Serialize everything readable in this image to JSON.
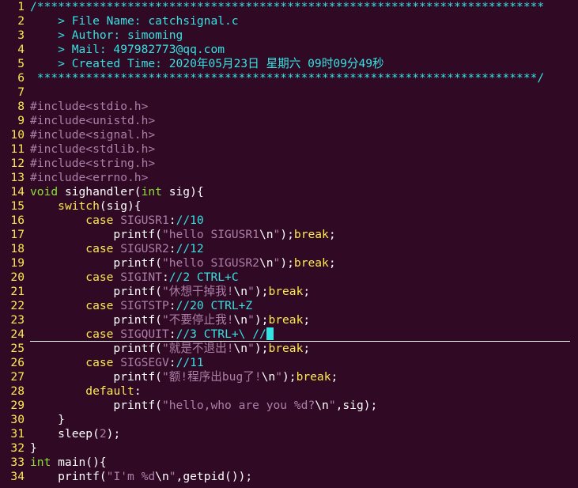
{
  "editor": {
    "file_name": "catchsignal.c",
    "mode": "vim",
    "colors": {
      "background": "#300a24",
      "line_number": "#fce94f",
      "comment": "#34e2e2",
      "preproc": "#ad7fa8",
      "type": "#8ae234",
      "statement": "#fce94f",
      "string": "#ad7fa8",
      "constant": "#ad7fa8",
      "normal": "#ffffff",
      "cursor": "#34e2e2"
    },
    "lines": [
      {
        "num": "1",
        "tokens": [
          {
            "c": "comment",
            "t": "/*************************************************************************"
          }
        ]
      },
      {
        "num": "2",
        "tokens": [
          {
            "c": "comment",
            "t": "    > File Name: catchsignal.c"
          }
        ]
      },
      {
        "num": "3",
        "tokens": [
          {
            "c": "comment",
            "t": "    > Author: simoming"
          }
        ]
      },
      {
        "num": "4",
        "tokens": [
          {
            "c": "comment",
            "t": "    > Mail: 497982773@qq.com"
          }
        ]
      },
      {
        "num": "5",
        "tokens": [
          {
            "c": "comment",
            "t": "    > Created Time: 2020年05月23日 星期六 09时09分49秒"
          }
        ]
      },
      {
        "num": "6",
        "tokens": [
          {
            "c": "comment",
            "t": " ************************************************************************/"
          }
        ]
      },
      {
        "num": "7",
        "tokens": []
      },
      {
        "num": "8",
        "tokens": [
          {
            "c": "preproc",
            "t": "#include"
          },
          {
            "c": "string",
            "t": "<stdio.h>"
          }
        ]
      },
      {
        "num": "9",
        "tokens": [
          {
            "c": "preproc",
            "t": "#include"
          },
          {
            "c": "string",
            "t": "<unistd.h>"
          }
        ]
      },
      {
        "num": "10",
        "tokens": [
          {
            "c": "preproc",
            "t": "#include"
          },
          {
            "c": "string",
            "t": "<signal.h>"
          }
        ]
      },
      {
        "num": "11",
        "tokens": [
          {
            "c": "preproc",
            "t": "#include"
          },
          {
            "c": "string",
            "t": "<stdlib.h>"
          }
        ]
      },
      {
        "num": "12",
        "tokens": [
          {
            "c": "preproc",
            "t": "#include"
          },
          {
            "c": "string",
            "t": "<string.h>"
          }
        ]
      },
      {
        "num": "13",
        "tokens": [
          {
            "c": "preproc",
            "t": "#include"
          },
          {
            "c": "string",
            "t": "<errno.h>"
          }
        ]
      },
      {
        "num": "14",
        "tokens": [
          {
            "c": "type",
            "t": "void"
          },
          {
            "c": "normal",
            "t": " sighandler("
          },
          {
            "c": "type",
            "t": "int"
          },
          {
            "c": "normal",
            "t": " sig){"
          }
        ]
      },
      {
        "num": "15",
        "tokens": [
          {
            "c": "normal",
            "t": "    "
          },
          {
            "c": "statement",
            "t": "switch"
          },
          {
            "c": "normal",
            "t": "(sig){"
          }
        ]
      },
      {
        "num": "16",
        "tokens": [
          {
            "c": "normal",
            "t": "        "
          },
          {
            "c": "statement",
            "t": "case"
          },
          {
            "c": "normal",
            "t": " "
          },
          {
            "c": "constant",
            "t": "SIGUSR1"
          },
          {
            "c": "normal",
            "t": ":"
          },
          {
            "c": "comment",
            "t": "//10"
          }
        ]
      },
      {
        "num": "17",
        "tokens": [
          {
            "c": "normal",
            "t": "            printf("
          },
          {
            "c": "string",
            "t": "\"hello SIGUSR1"
          },
          {
            "c": "normal",
            "t": "\\n"
          },
          {
            "c": "string",
            "t": "\""
          },
          {
            "c": "normal",
            "t": ");"
          },
          {
            "c": "statement",
            "t": "break"
          },
          {
            "c": "normal",
            "t": ";"
          }
        ]
      },
      {
        "num": "18",
        "tokens": [
          {
            "c": "normal",
            "t": "        "
          },
          {
            "c": "statement",
            "t": "case"
          },
          {
            "c": "normal",
            "t": " "
          },
          {
            "c": "constant",
            "t": "SIGUSR2"
          },
          {
            "c": "normal",
            "t": ":"
          },
          {
            "c": "comment",
            "t": "//12"
          }
        ]
      },
      {
        "num": "19",
        "tokens": [
          {
            "c": "normal",
            "t": "            printf("
          },
          {
            "c": "string",
            "t": "\"hello SIGUSR2"
          },
          {
            "c": "normal",
            "t": "\\n"
          },
          {
            "c": "string",
            "t": "\""
          },
          {
            "c": "normal",
            "t": ");"
          },
          {
            "c": "statement",
            "t": "break"
          },
          {
            "c": "normal",
            "t": ";"
          }
        ]
      },
      {
        "num": "20",
        "tokens": [
          {
            "c": "normal",
            "t": "        "
          },
          {
            "c": "statement",
            "t": "case"
          },
          {
            "c": "normal",
            "t": " "
          },
          {
            "c": "constant",
            "t": "SIGINT"
          },
          {
            "c": "normal",
            "t": ":"
          },
          {
            "c": "comment",
            "t": "//2 CTRL+C"
          }
        ]
      },
      {
        "num": "21",
        "tokens": [
          {
            "c": "normal",
            "t": "            printf("
          },
          {
            "c": "string",
            "t": "\"休想干掉我!"
          },
          {
            "c": "normal",
            "t": "\\n"
          },
          {
            "c": "string",
            "t": "\""
          },
          {
            "c": "normal",
            "t": ");"
          },
          {
            "c": "statement",
            "t": "break"
          },
          {
            "c": "normal",
            "t": ";"
          }
        ]
      },
      {
        "num": "22",
        "tokens": [
          {
            "c": "normal",
            "t": "        "
          },
          {
            "c": "statement",
            "t": "case"
          },
          {
            "c": "normal",
            "t": " "
          },
          {
            "c": "constant",
            "t": "SIGTSTP"
          },
          {
            "c": "normal",
            "t": ":"
          },
          {
            "c": "comment",
            "t": "//20 CTRL+Z"
          }
        ]
      },
      {
        "num": "23",
        "tokens": [
          {
            "c": "normal",
            "t": "            printf("
          },
          {
            "c": "string",
            "t": "\"不要停止我!"
          },
          {
            "c": "normal",
            "t": "\\n"
          },
          {
            "c": "string",
            "t": "\""
          },
          {
            "c": "normal",
            "t": ");"
          },
          {
            "c": "statement",
            "t": "break"
          },
          {
            "c": "normal",
            "t": ";"
          }
        ]
      },
      {
        "num": "24",
        "cursorline": true,
        "tokens": [
          {
            "c": "normal",
            "t": "        "
          },
          {
            "c": "statement",
            "t": "case"
          },
          {
            "c": "normal",
            "t": " "
          },
          {
            "c": "constant",
            "t": "SIGQUIT"
          },
          {
            "c": "normal",
            "t": ":"
          },
          {
            "c": "comment",
            "t": "//3 CTRL+\\ //"
          },
          {
            "c": "cursor",
            "t": ""
          }
        ]
      },
      {
        "num": "25",
        "tokens": [
          {
            "c": "normal",
            "t": "            printf("
          },
          {
            "c": "string",
            "t": "\"就是不退出!"
          },
          {
            "c": "normal",
            "t": "\\n"
          },
          {
            "c": "string",
            "t": "\""
          },
          {
            "c": "normal",
            "t": ");"
          },
          {
            "c": "statement",
            "t": "break"
          },
          {
            "c": "normal",
            "t": ";"
          }
        ]
      },
      {
        "num": "26",
        "tokens": [
          {
            "c": "normal",
            "t": "        "
          },
          {
            "c": "statement",
            "t": "case"
          },
          {
            "c": "normal",
            "t": " "
          },
          {
            "c": "constant",
            "t": "SIGSEGV"
          },
          {
            "c": "normal",
            "t": ":"
          },
          {
            "c": "comment",
            "t": "//11"
          }
        ]
      },
      {
        "num": "27",
        "tokens": [
          {
            "c": "normal",
            "t": "            printf("
          },
          {
            "c": "string",
            "t": "\"额!程序出bug了!"
          },
          {
            "c": "normal",
            "t": "\\n"
          },
          {
            "c": "string",
            "t": "\""
          },
          {
            "c": "normal",
            "t": ");"
          },
          {
            "c": "statement",
            "t": "break"
          },
          {
            "c": "normal",
            "t": ";"
          }
        ]
      },
      {
        "num": "28",
        "tokens": [
          {
            "c": "normal",
            "t": "        "
          },
          {
            "c": "statement",
            "t": "default"
          },
          {
            "c": "normal",
            "t": ":"
          }
        ]
      },
      {
        "num": "29",
        "tokens": [
          {
            "c": "normal",
            "t": "            printf("
          },
          {
            "c": "string",
            "t": "\"hello,who are you %d?"
          },
          {
            "c": "normal",
            "t": "\\n"
          },
          {
            "c": "string",
            "t": "\""
          },
          {
            "c": "normal",
            "t": ",sig);"
          }
        ]
      },
      {
        "num": "30",
        "tokens": [
          {
            "c": "normal",
            "t": "    }"
          }
        ]
      },
      {
        "num": "31",
        "tokens": [
          {
            "c": "normal",
            "t": "    sleep("
          },
          {
            "c": "constant",
            "t": "2"
          },
          {
            "c": "normal",
            "t": ");"
          }
        ]
      },
      {
        "num": "32",
        "tokens": [
          {
            "c": "normal",
            "t": "}"
          }
        ]
      },
      {
        "num": "33",
        "tokens": [
          {
            "c": "type",
            "t": "int"
          },
          {
            "c": "normal",
            "t": " main(){"
          }
        ]
      },
      {
        "num": "34",
        "tokens": [
          {
            "c": "normal",
            "t": "    printf("
          },
          {
            "c": "string",
            "t": "\"I'm %d"
          },
          {
            "c": "normal",
            "t": "\\n"
          },
          {
            "c": "string",
            "t": "\""
          },
          {
            "c": "normal",
            "t": ",getpid());"
          }
        ]
      }
    ]
  }
}
